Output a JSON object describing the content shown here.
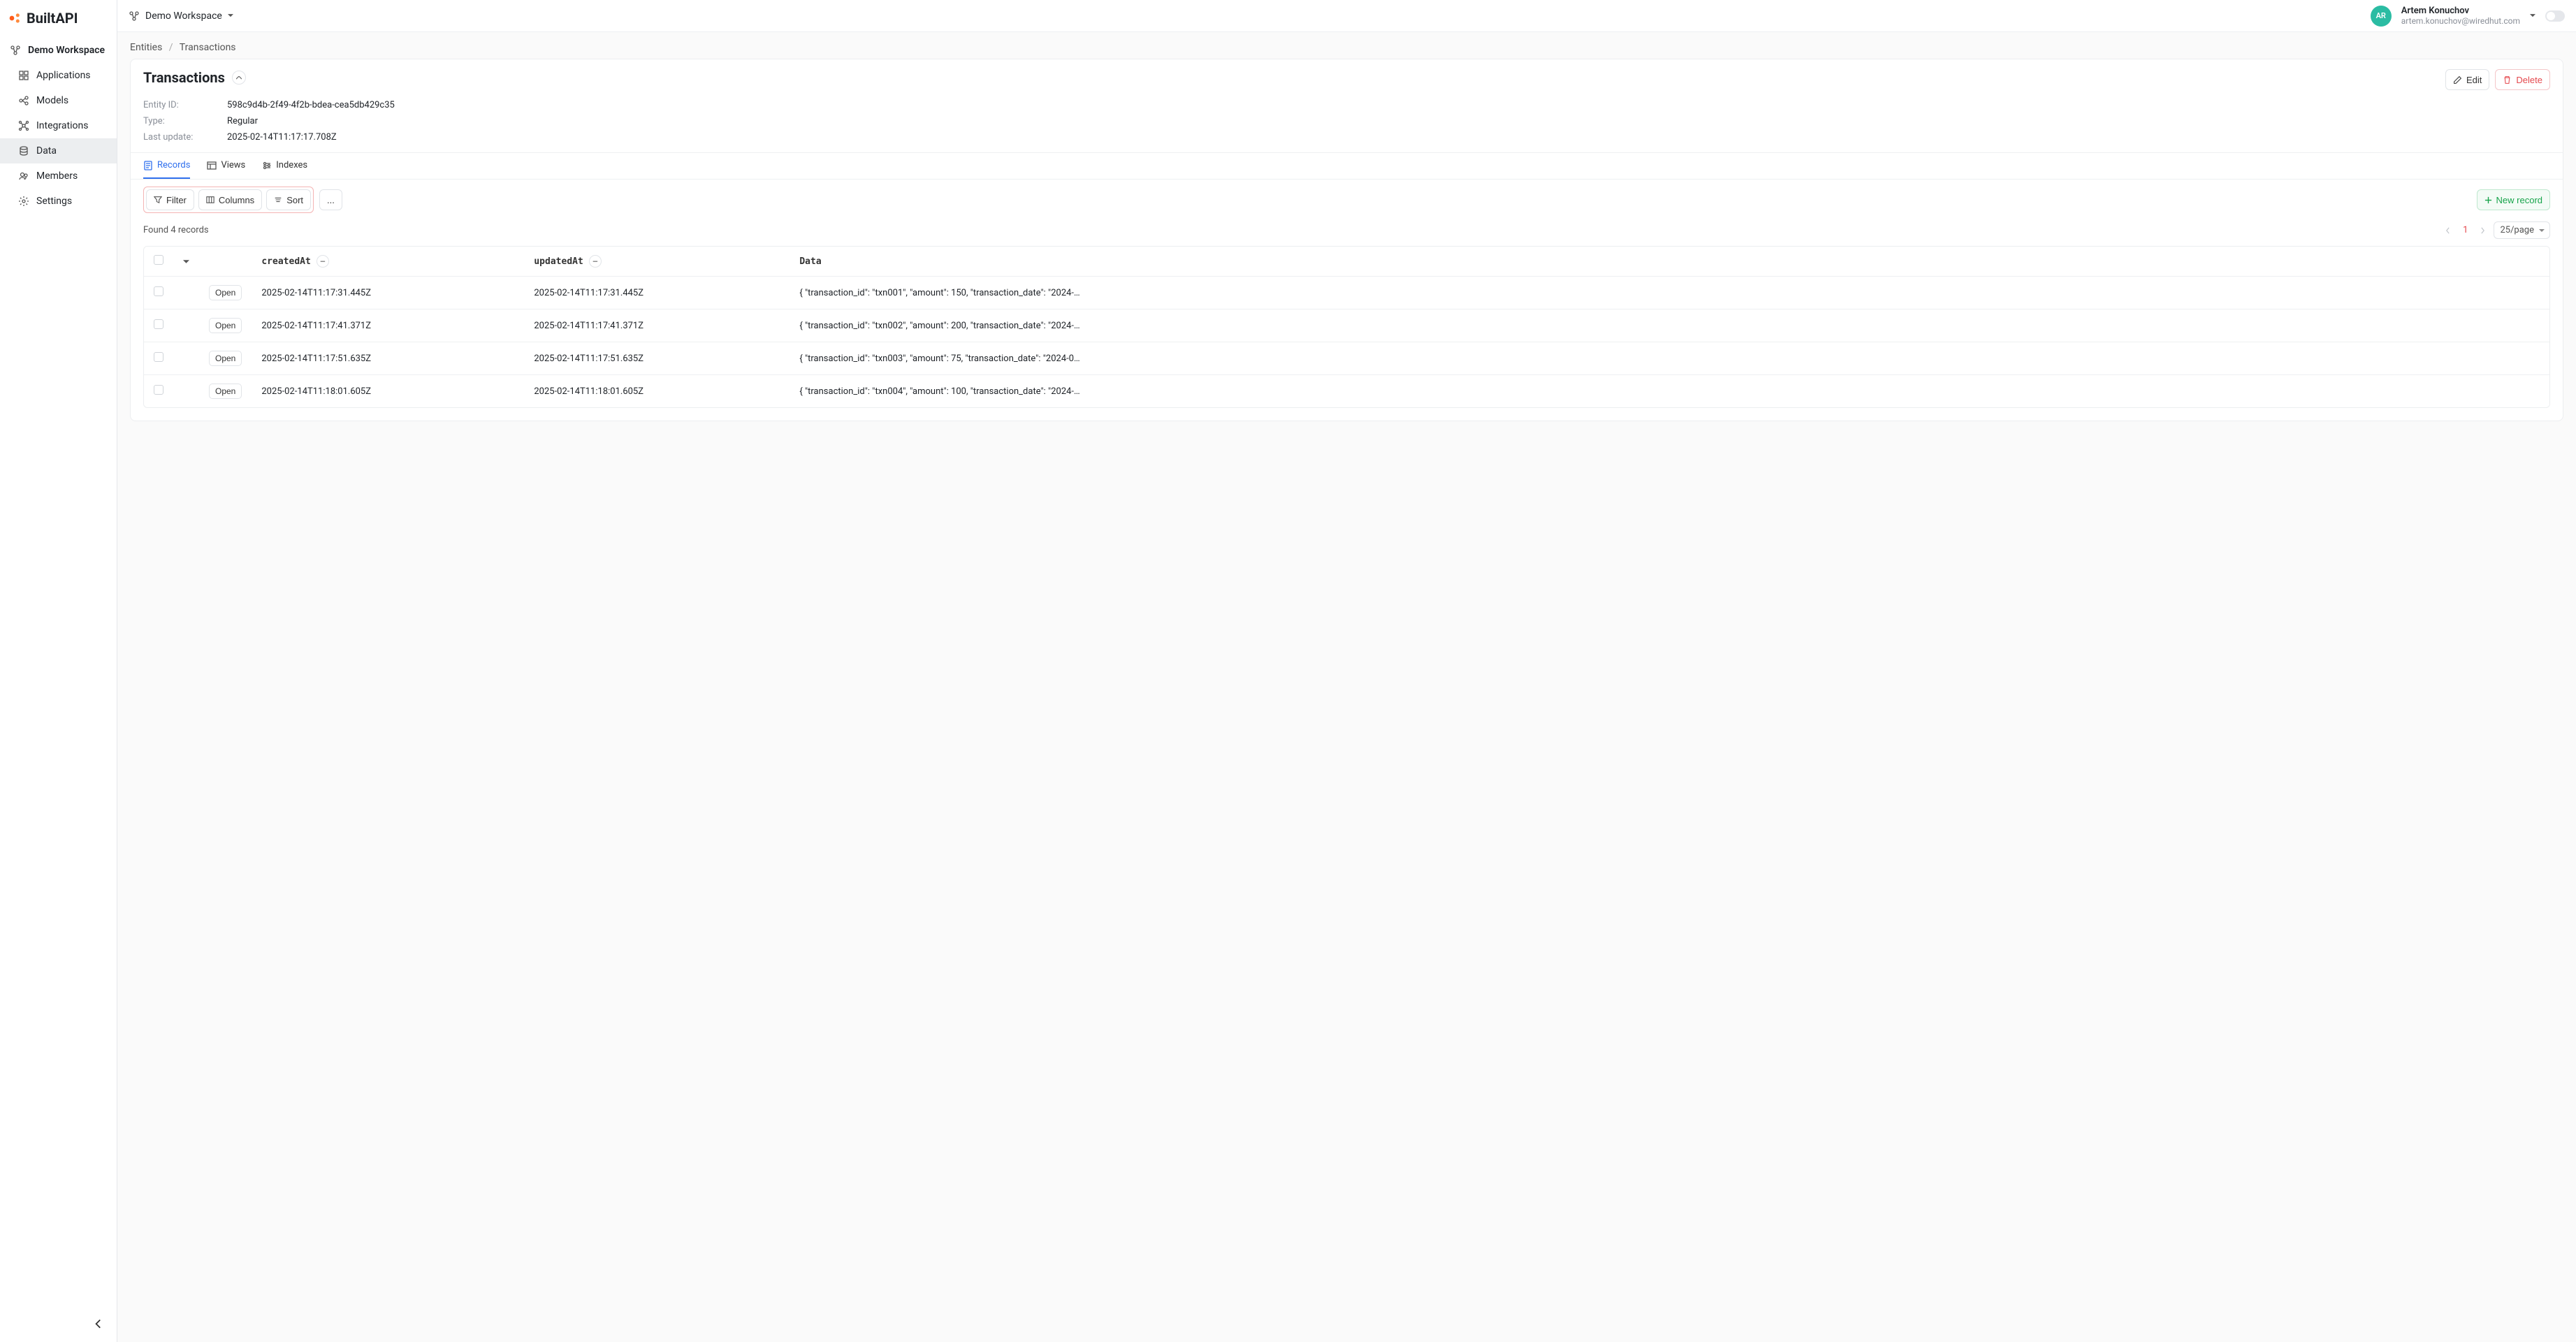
{
  "brand": "BuiltAPI",
  "workspace_selector": "Demo Workspace",
  "user": {
    "initials": "AR",
    "name": "Artem Konuchov",
    "email": "artem.konuchov@wiredhut.com"
  },
  "sidebar": {
    "workspace": "Demo Workspace",
    "items": [
      {
        "label": "Applications"
      },
      {
        "label": "Models"
      },
      {
        "label": "Integrations"
      },
      {
        "label": "Data"
      },
      {
        "label": "Members"
      },
      {
        "label": "Settings"
      }
    ]
  },
  "breadcrumb": {
    "root": "Entities",
    "current": "Transactions"
  },
  "entity": {
    "title": "Transactions",
    "id_label": "Entity ID:",
    "id_value": "598c9d4b-2f49-4f2b-bdea-cea5db429c35",
    "type_label": "Type:",
    "type_value": "Regular",
    "updated_label": "Last update:",
    "updated_value": "2025-02-14T11:17:17.708Z",
    "edit_label": "Edit",
    "delete_label": "Delete"
  },
  "tabs": {
    "records": "Records",
    "views": "Views",
    "indexes": "Indexes"
  },
  "toolbar": {
    "filter": "Filter",
    "columns": "Columns",
    "sort": "Sort",
    "more": "...",
    "new_record": "New record"
  },
  "found_text": "Found 4 records",
  "pagination": {
    "page": "1",
    "page_size": "25/page"
  },
  "table": {
    "headers": {
      "createdAt": "createdAt",
      "updatedAt": "updatedAt",
      "data": "Data"
    },
    "open_label": "Open",
    "rows": [
      {
        "createdAt": "2025-02-14T11:17:31.445Z",
        "updatedAt": "2025-02-14T11:17:31.445Z",
        "data": "{ \"transaction_id\": \"txn001\", \"amount\": 150, \"transaction_date\": \"2024-…"
      },
      {
        "createdAt": "2025-02-14T11:17:41.371Z",
        "updatedAt": "2025-02-14T11:17:41.371Z",
        "data": "{ \"transaction_id\": \"txn002\", \"amount\": 200, \"transaction_date\": \"2024-…"
      },
      {
        "createdAt": "2025-02-14T11:17:51.635Z",
        "updatedAt": "2025-02-14T11:17:51.635Z",
        "data": "{ \"transaction_id\": \"txn003\", \"amount\": 75, \"transaction_date\": \"2024-0…"
      },
      {
        "createdAt": "2025-02-14T11:18:01.605Z",
        "updatedAt": "2025-02-14T11:18:01.605Z",
        "data": "{ \"transaction_id\": \"txn004\", \"amount\": 100, \"transaction_date\": \"2024-…"
      }
    ]
  }
}
